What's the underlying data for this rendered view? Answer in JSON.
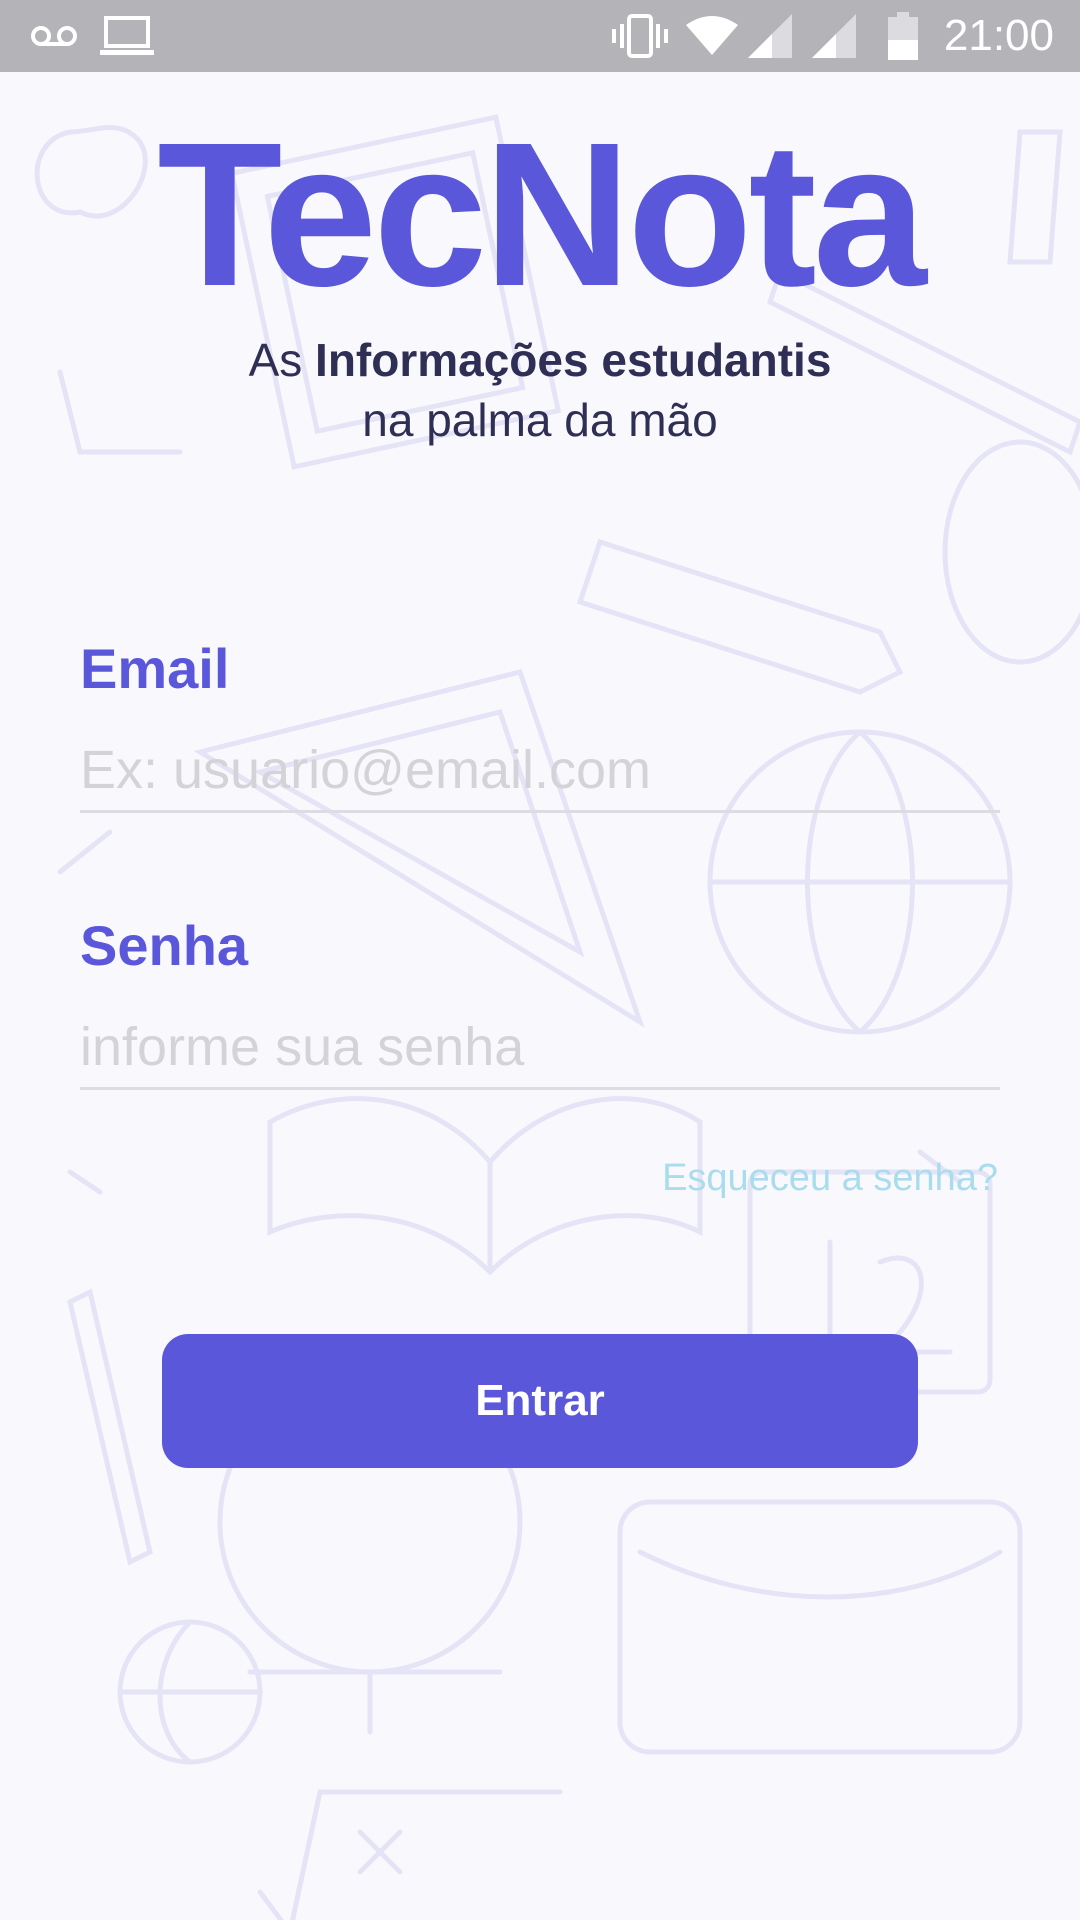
{
  "status_bar": {
    "time": "21:00",
    "icons": [
      "voicemail-icon",
      "laptop-icon",
      "vibrate-icon",
      "wifi-icon",
      "signal-icon",
      "signal-icon",
      "battery-icon"
    ]
  },
  "app": {
    "logo": "TecNota",
    "tagline_prefix": "As ",
    "tagline_bold": "Informações estudantis",
    "tagline_line2": "na palma da mão"
  },
  "form": {
    "email_label": "Email",
    "email_placeholder": "Ex: usuario@email.com",
    "email_value": "",
    "password_label": "Senha",
    "password_placeholder": "informe sua senha",
    "password_value": "",
    "forgot_link": "Esqueceu a senha?",
    "submit_label": "Entrar"
  },
  "colors": {
    "brand": "#5a57db",
    "link": "#a9dced",
    "status_bar": "#b4b4b8"
  }
}
